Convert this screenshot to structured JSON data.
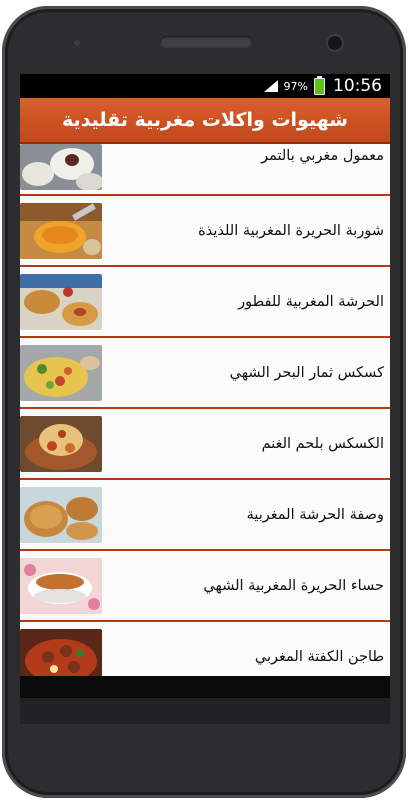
{
  "status": {
    "battery_percent": "97%",
    "battery_level": 0.97,
    "time": "10:56",
    "icons": [
      "signal-icon",
      "battery-icon"
    ]
  },
  "app": {
    "title": "شهيوات واكلات مغربية تقليدية",
    "accent_color": "#cf5023",
    "divider_color": "#b8380f"
  },
  "recipes": [
    {
      "title": "معمول مغربي بالتمر",
      "thumb": "maamoul-image"
    },
    {
      "title": "شوربة الحريرة المغربية اللذيذة",
      "thumb": "harira-soup-image"
    },
    {
      "title": "الحرشة المغربية للفطور",
      "thumb": "harcha-breakfast-image"
    },
    {
      "title": "كسكس ثمار البحر الشهي",
      "thumb": "seafood-couscous-image"
    },
    {
      "title": "الكسكس بلحم الغنم",
      "thumb": "lamb-couscous-image"
    },
    {
      "title": "وصفة الحرشة المغربية",
      "thumb": "harcha-recipe-image"
    },
    {
      "title": "حساء الحريرة المغربية الشهي",
      "thumb": "harira-bowl-image"
    },
    {
      "title": "طاجن الكفتة المغربي",
      "thumb": "kefta-tagine-image"
    }
  ]
}
